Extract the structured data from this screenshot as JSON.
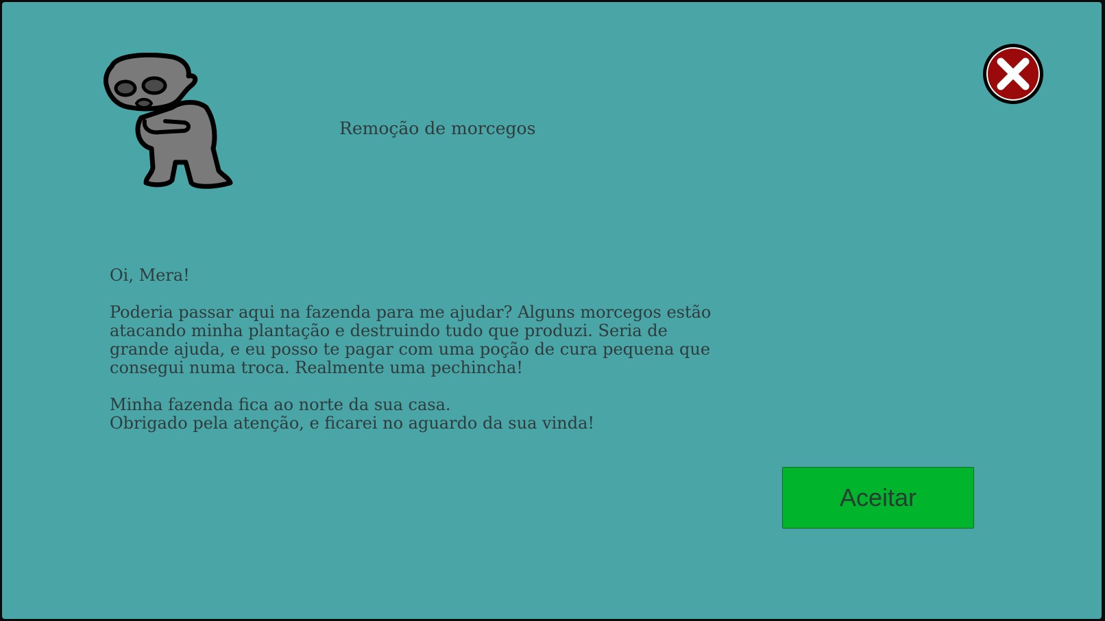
{
  "quest": {
    "title": "Remoção de morcegos",
    "greeting": "Oi, Mera!",
    "paragraph1": "Poderia passar aqui na fazenda para me ajudar? Alguns morcegos estão\natacando minha plantação e destruindo tudo que produzi. Seria de\ngrande ajuda, e eu posso te pagar com uma poção de cura pequena que\nconsegui numa troca. Realmente uma pechincha!",
    "paragraph2": "Minha fazenda fica ao norte da sua casa.\nObrigado pela atenção, e ficarei no aguardo da sua vinda!"
  },
  "buttons": {
    "accept_label": "Aceitar",
    "close_icon": "close-icon"
  },
  "portrait": {
    "icon": "npc-portrait-icon"
  },
  "colors": {
    "background": "#4aa5a6",
    "accept": "#00b52b",
    "close": "#9b0a0a",
    "text": "#2f3b3d"
  }
}
